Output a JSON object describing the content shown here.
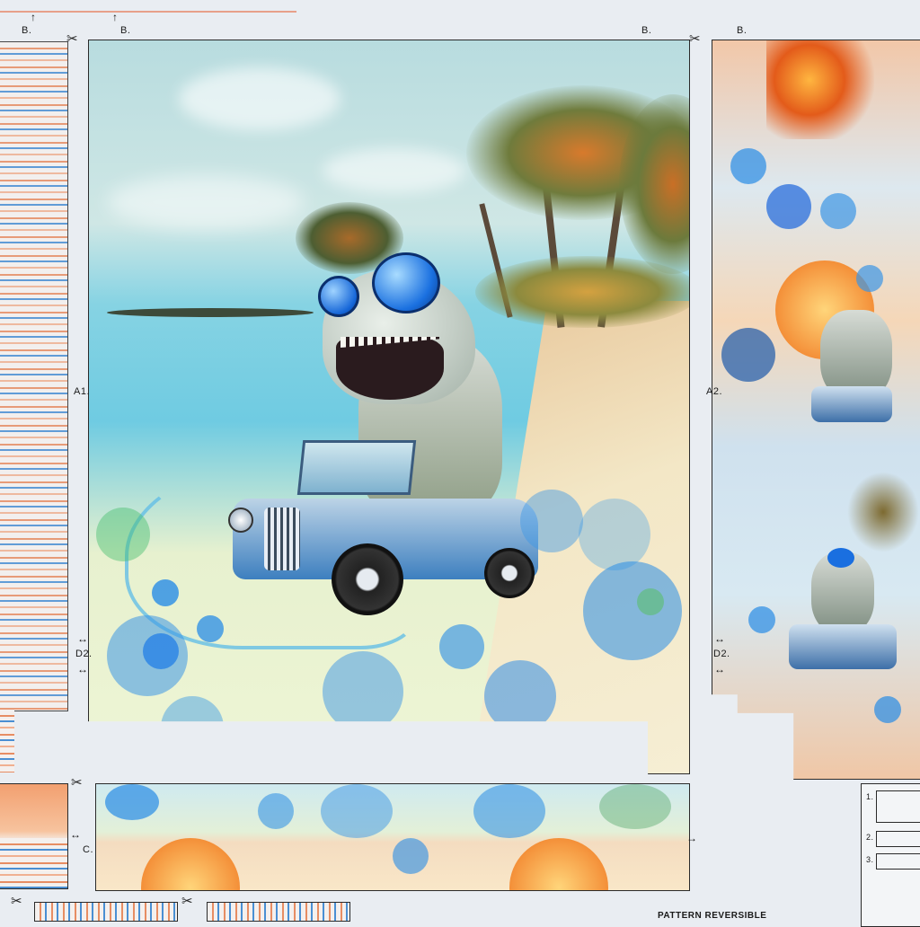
{
  "labels": {
    "b1": "B.",
    "b2": "B.",
    "b3": "B.",
    "b4": "B.",
    "a1": "A1.",
    "a2": "A2.",
    "d2_left": "D2.",
    "d2_right": "D2.",
    "c": "C.",
    "steps": [
      "1.",
      "2.",
      "3."
    ],
    "footer": "PATTERN REVERSIBLE"
  },
  "icons": {
    "scissors": "scissors-icon",
    "arrow": "arrow-icon"
  },
  "colors": {
    "paper": "#e9edf2",
    "sea": "#5fc6df",
    "sky": "#bfe1e6",
    "sand": "#f3e7c6",
    "bubble_blue": "#2f8ee0",
    "stripe_orange": "#e78d63",
    "stripe_blue": "#4a8fd3"
  }
}
